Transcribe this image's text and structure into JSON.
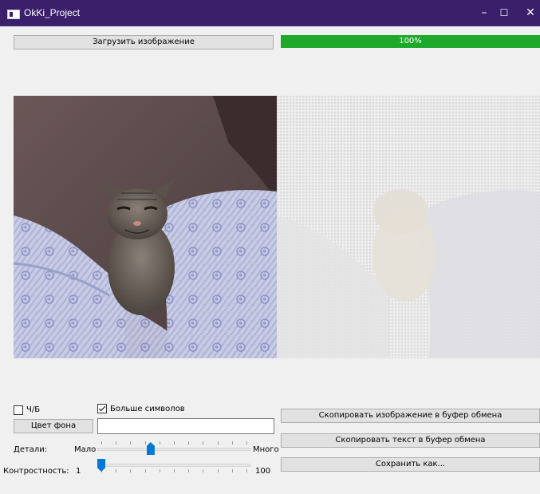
{
  "window": {
    "title": "OkKi_Project",
    "minimize_glyph": "–",
    "maximize_glyph": "☐",
    "close_glyph": "✕"
  },
  "toolbar": {
    "load_button_label": "Загрузить изображение"
  },
  "progress": {
    "value_percent": 100,
    "label": "100%",
    "fill_color": "#1daa2a"
  },
  "images": {
    "source_icon": "kitten-photo",
    "result_icon": "ascii-art-preview"
  },
  "controls": {
    "bw_label": "Ч/Б",
    "bw_checked": false,
    "more_symbols_label": "Больше символов",
    "more_symbols_checked": true,
    "bg_color_button": "Цвет фона",
    "bg_color_value": "",
    "details_label": "Детали:",
    "details_min_label": "Мало",
    "details_max_label": "Много",
    "details_value_fraction": 0.34,
    "contrast_label": "Контростность:",
    "contrast_min": "1",
    "contrast_max": "100",
    "contrast_value": 1
  },
  "actions": {
    "copy_image": "Скопировать изображение в буфер обмена",
    "copy_text": "Скопировать текст в буфер обмена",
    "save_as": "Сохранить как..."
  },
  "colors": {
    "titlebar": "#3a1f6a",
    "accent": "#0078d7"
  }
}
